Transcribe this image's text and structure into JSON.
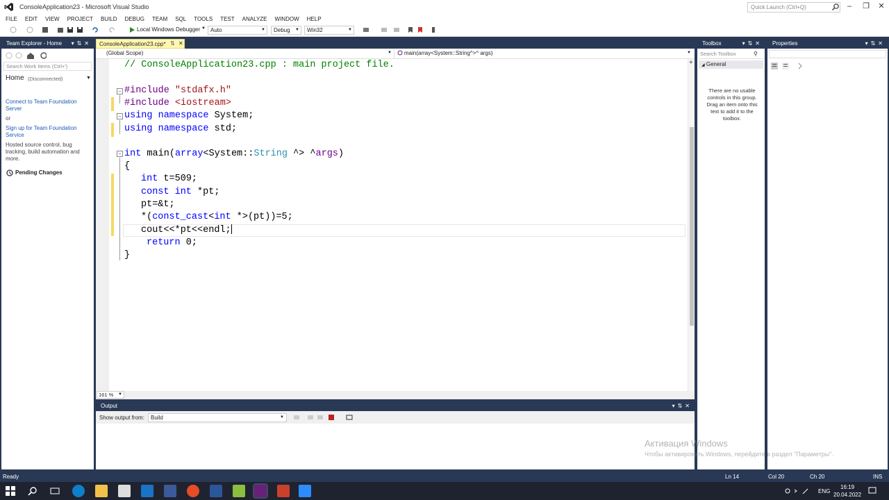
{
  "window": {
    "title": "ConsoleApplication23 - Microsoft Visual Studio",
    "quick_launch": "Quick Launch (Ctrl+Q)"
  },
  "menu": [
    "FILE",
    "EDIT",
    "VIEW",
    "PROJECT",
    "BUILD",
    "DEBUG",
    "TEAM",
    "SQL",
    "TOOLS",
    "TEST",
    "ANALYZE",
    "WINDOW",
    "HELP"
  ],
  "toolbar": {
    "debugger": "Local Windows Debugger",
    "config_auto": "Auto",
    "config": "Debug",
    "platform": "Win32"
  },
  "team_explorer": {
    "title": "Team Explorer - Home",
    "search_placeholder": "Search Work Items (Ctrl+')",
    "home": "Home",
    "disconnected": "(Disconnected)",
    "connect_link": "Connect to Team Foundation Server",
    "or": "or",
    "signup_link": "Sign up for Team Foundation Service",
    "desc": "Hosted source control, bug tracking, build automation and more.",
    "pending": "Pending Changes"
  },
  "editor": {
    "tab": "ConsoleApplication23.cpp*",
    "scope": "(Global Scope)",
    "member": "main(array<System::String^>^ args)",
    "zoom": "161 %"
  },
  "code": {
    "l1": "// ConsoleApplication23.cpp : main project file.",
    "l3a": "#include",
    "l3b": "\"stdafx.h\"",
    "l4a": "#include",
    "l4b": "<iostream>",
    "l5a": "using namespace",
    "l5b": "System;",
    "l6a": "using namespace",
    "l6b": "std;",
    "l8a": "int",
    "l8b": "main(",
    "l8c": "array",
    "l8d": "<System::",
    "l8e": "String",
    "l8f": " ^> ^",
    "l8g": "args",
    "l8h": ")",
    "l9": "{",
    "l10a": "int",
    "l10b": "t=509;",
    "l11a": "const int",
    "l11b": "*pt;",
    "l12": "pt=&t;",
    "l13a": "*(",
    "l13b": "const_cast",
    "l13c": "<",
    "l13d": "int",
    "l13e": "*>(pt))=5;",
    "l14": "cout<<*pt<<endl;",
    "l15a": "return",
    "l15b": "0;",
    "l16": "}"
  },
  "output": {
    "title": "Output",
    "show_from_label": "Show output from:",
    "show_from_value": "Build"
  },
  "toolbox": {
    "title": "Toolbox",
    "search_placeholder": "Search Toolbox",
    "group": "General",
    "empty_msg": "There are no usable controls in this group. Drag an item onto this text to add it to the toolbox."
  },
  "properties": {
    "title": "Properties"
  },
  "watermark": {
    "line1": "Активация Windows",
    "line2": "Чтобы активировать Windows, перейдите в раздел \"Параметры\"."
  },
  "status": {
    "ready": "Ready",
    "ln": "Ln 14",
    "col": "Col 20",
    "ch": "Ch 20",
    "ins": "INS"
  },
  "taskbar": {
    "lang": "ENG",
    "time": "16:19",
    "date": "20.04.2022"
  },
  "colors": {
    "frame": "#293955",
    "accent": "#68217a",
    "keyword": "#0000ff",
    "comment": "#008000",
    "string": "#a31515",
    "type": "#2b91af"
  }
}
